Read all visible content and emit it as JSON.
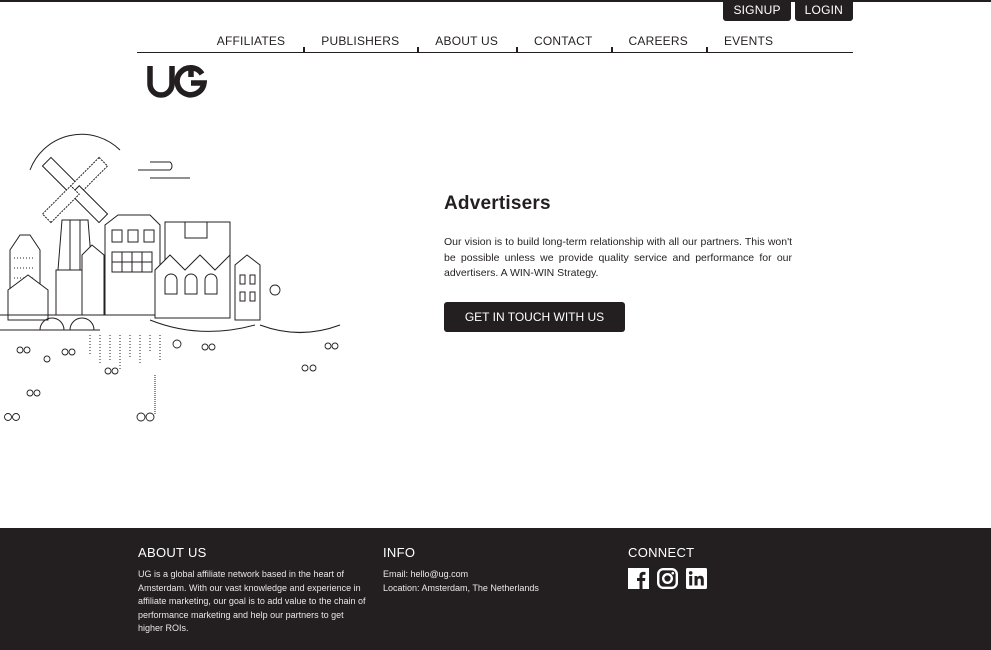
{
  "header": {
    "signup_label": "SIGNUP",
    "login_label": "LOGIN"
  },
  "nav": {
    "items": [
      {
        "label": "AFFILIATES"
      },
      {
        "label": "PUBLISHERS"
      },
      {
        "label": "ABOUT US"
      },
      {
        "label": "CONTACT"
      },
      {
        "label": "CAREERS"
      },
      {
        "label": "EVENTS"
      }
    ]
  },
  "brand": {
    "logo_text": "UG",
    "color": "#231f20"
  },
  "hero": {
    "title": "Advertisers",
    "description": "Our vision is to build long-term relationship with all our partners. This won't be possible unless we provide quality service and performance for our advertisers. A WIN-WIN Strategy.",
    "cta_label": "GET IN TOUCH WITH US"
  },
  "footer": {
    "about": {
      "heading": "ABOUT US",
      "text": "UG is a global affiliate network based in the heart of Amsterdam. With our vast knowledge and experience in affiliate marketing, our goal is to add value to the chain of performance marketing and help our partners to get higher ROIs."
    },
    "info": {
      "heading": "INFO",
      "email": "Email: hello@ug.com",
      "location": "Location: Amsterdam, The Netherlands"
    },
    "connect": {
      "heading": "CONNECT",
      "socials": [
        "facebook-icon",
        "instagram-icon",
        "linkedin-icon"
      ]
    }
  }
}
